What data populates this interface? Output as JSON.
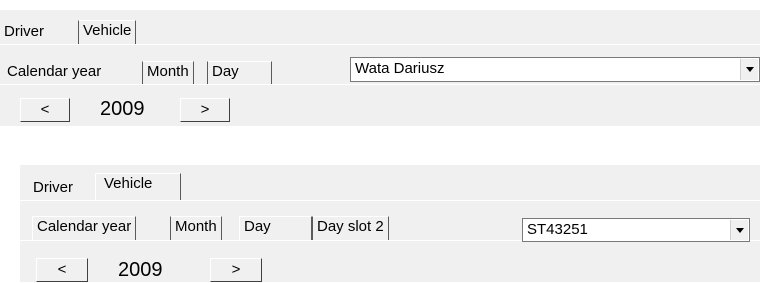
{
  "panel1": {
    "main_tabs": [
      "Driver",
      "Vehicle"
    ],
    "sub_tabs": [
      "Calendar year",
      "Month",
      "Day"
    ],
    "selector_value": "Wata Dariusz",
    "prev_label": "<",
    "next_label": ">",
    "year": "2009"
  },
  "panel2": {
    "main_tabs": [
      "Driver",
      "Vehicle"
    ],
    "sub_tabs": [
      "Calendar year",
      "Month",
      "Day",
      "Day slot 2"
    ],
    "selector_value": "ST43251",
    "prev_label": "<",
    "next_label": ">",
    "year": "2009"
  }
}
